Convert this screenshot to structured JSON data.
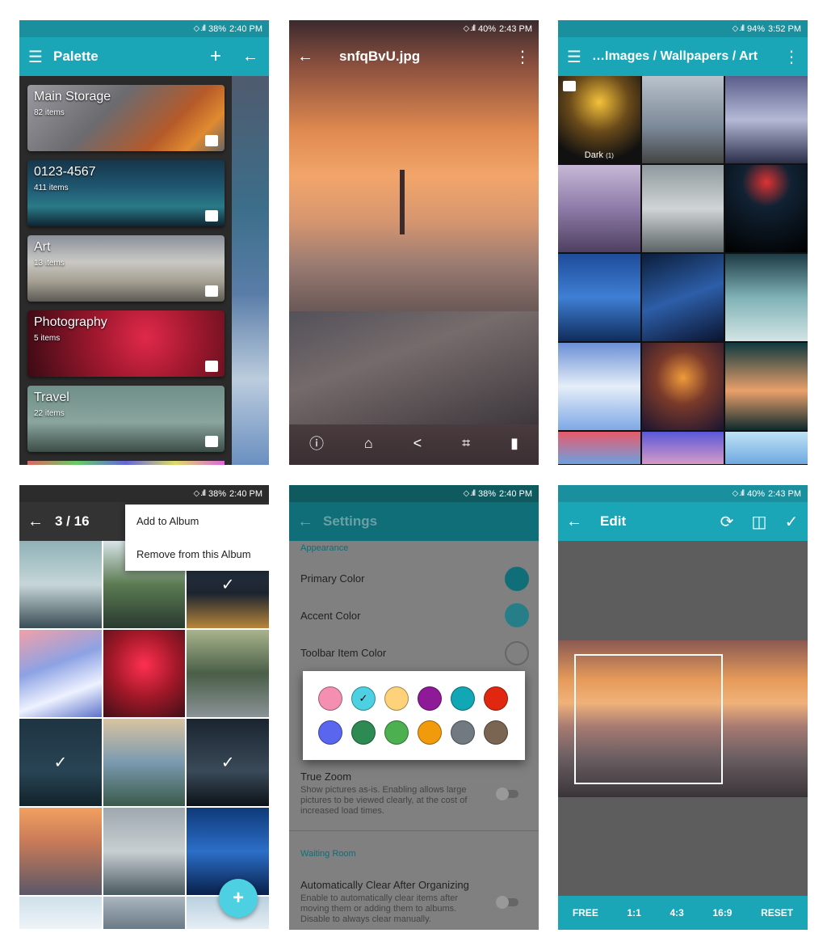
{
  "colors": {
    "teal": "#1aa6b7",
    "teal_dark": "#1a8f9d",
    "fab": "#4dd0e1"
  },
  "s1": {
    "status": {
      "signal": "◇ .ıll",
      "battery": "38%",
      "time": "2:40 PM"
    },
    "title": "Palette",
    "icons": {
      "menu": "menu-icon",
      "add": "plus-icon",
      "back": "arrow-left-icon"
    },
    "albums": [
      {
        "name": "Main Storage",
        "count": "82 items",
        "icon": "folder-icon"
      },
      {
        "name": "0123-4567",
        "count": "411 items",
        "icon": "folder-icon"
      },
      {
        "name": "Art",
        "count": "13 items",
        "icon": "image-icon"
      },
      {
        "name": "Photography",
        "count": "5 items",
        "icon": "image-icon"
      },
      {
        "name": "Travel",
        "count": "22 items",
        "icon": "image-icon"
      }
    ]
  },
  "s2": {
    "status": {
      "signal": "◇ .ıll",
      "battery": "40%",
      "time": "2:43 PM"
    },
    "title": "snfqBvU.jpg",
    "actions": [
      "info-icon",
      "home-icon",
      "share-icon",
      "crop-icon",
      "delete-icon"
    ]
  },
  "s3": {
    "status": {
      "signal": "◇ .ıll",
      "battery": "94%",
      "time": "3:52 PM"
    },
    "title": "…Images / Wallpapers / Art",
    "folder_label": "Dark",
    "folder_count": "(1)"
  },
  "s4": {
    "status": {
      "signal": "◇ .ıll",
      "battery": "38%",
      "time": "2:40 PM"
    },
    "counter": "3 / 16",
    "menu": [
      "Add to Album",
      "Remove from this Album"
    ],
    "fab": "+"
  },
  "s5": {
    "status": {
      "signal": "◇ .ıll",
      "battery": "38%",
      "time": "2:40 PM"
    },
    "title": "Settings",
    "section_appearance": "Appearance",
    "primary_color": "Primary Color",
    "accent_color": "Accent Color",
    "toolbar_item_color": "Toolbar Item Color",
    "true_zoom": "True Zoom",
    "true_zoom_desc": "Show pictures as-is. Enabling allows large pictures to be viewed clearly, at the cost of increased load times.",
    "section_waiting": "Waiting Room",
    "auto_clear": "Automatically Clear After Organizing",
    "auto_clear_desc": "Enable to automatically clear items after moving them or adding them to albums. Disable to always clear manually.",
    "palette": [
      "#f48fb1",
      "#4dd0e1",
      "#fdd27a",
      "#8e1a98",
      "#12a7b5",
      "#e0270f",
      "#5b66ef",
      "#2c8a52",
      "#4caf50",
      "#f19b0c",
      "#707a80",
      "#7a6552"
    ],
    "selected_index": 1,
    "primary_hex": "#0f6e78",
    "accent_hex": "#267f88"
  },
  "s6": {
    "status": {
      "signal": "◇ .ıll",
      "battery": "40%",
      "time": "2:43 PM"
    },
    "title": "Edit",
    "ratios": [
      "FREE",
      "1:1",
      "4:3",
      "16:9",
      "RESET"
    ]
  }
}
